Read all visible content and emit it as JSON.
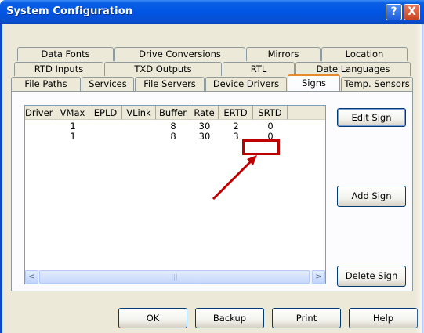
{
  "window": {
    "title": "System Configuration",
    "help_glyph": "?",
    "close_glyph": "X"
  },
  "tabs": {
    "row1": [
      "Data Fonts",
      "Drive Conversions",
      "Mirrors",
      "Location"
    ],
    "row2": [
      "RTD Inputs",
      "TXD Outputs",
      "RTL",
      "Date Languages"
    ],
    "row3": [
      "File Paths",
      "Services",
      "File Servers",
      "Device Drivers",
      "Signs",
      "Temp. Sensors"
    ],
    "active": "Signs"
  },
  "signs_table": {
    "columns": [
      "Driver",
      "VMax",
      "EPLD",
      "VLink",
      "Buffer",
      "Rate",
      "ERTD",
      "SRTD"
    ],
    "rows": [
      [
        "",
        "1",
        "",
        "",
        "8",
        "30",
        "2",
        "0"
      ],
      [
        "",
        "1",
        "",
        "",
        "8",
        "30",
        "3",
        "0"
      ]
    ],
    "scroll_left_glyph": "<",
    "scroll_right_glyph": ">",
    "thumb_grip": "|||"
  },
  "side_buttons": {
    "edit": "Edit Sign",
    "add": "Add Sign",
    "delete": "Delete Sign"
  },
  "bottom_buttons": {
    "ok": "OK",
    "backup": "Backup",
    "print": "Print",
    "help": "Help"
  },
  "annotation": {
    "color": "#c00000"
  }
}
